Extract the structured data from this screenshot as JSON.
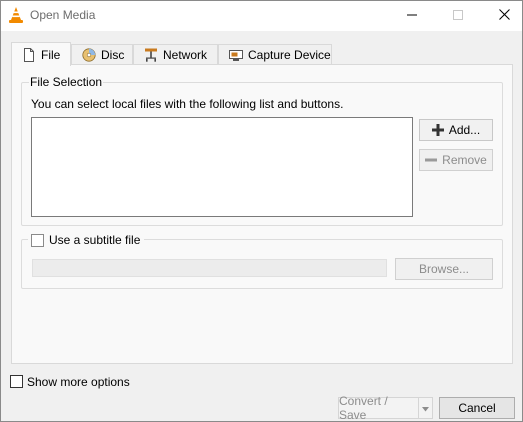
{
  "window": {
    "title": "Open Media",
    "app_icon": "vlc-cone-icon",
    "controls": [
      "minimize-icon",
      "maximize-icon",
      "close-icon"
    ]
  },
  "tabs": [
    {
      "label": "File",
      "icon": "file-icon",
      "active": true
    },
    {
      "label": "Disc",
      "icon": "disc-icon",
      "active": false
    },
    {
      "label": "Network",
      "icon": "network-icon",
      "active": false
    },
    {
      "label": "Capture Device",
      "icon": "capture-device-icon",
      "active": false
    }
  ],
  "file_selection": {
    "group_title": "File Selection",
    "hint": "You can select local files with the following list and buttons.",
    "add_label": "Add...",
    "remove_label": "Remove"
  },
  "subtitle": {
    "checkbox_label": "Use a subtitle file",
    "checked": false,
    "path_value": "",
    "browse_label": "Browse..."
  },
  "footer": {
    "show_more_label": "Show more options",
    "show_more_checked": false,
    "convert_label": "Convert / Save",
    "cancel_label": "Cancel"
  },
  "colors": {
    "vlc_orange": "#f28a00",
    "window_bg": "#f0f0f0",
    "panel_bg": "#f9f9f9",
    "add_icon": "#333333",
    "remove_icon_disabled": "#9a9a9a"
  }
}
